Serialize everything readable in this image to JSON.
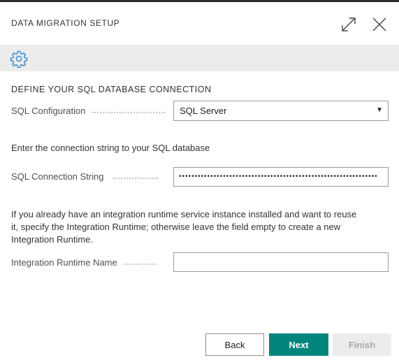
{
  "dialog": {
    "title": "DATA MIGRATION SETUP",
    "expand_icon": "expand-icon",
    "close_icon": "close-icon"
  },
  "action_bar": {
    "settings_icon": "gear-icon"
  },
  "section": {
    "title": "DEFINE YOUR SQL DATABASE CONNECTION"
  },
  "sql_configuration": {
    "label": "SQL Configuration",
    "value": "SQL Server"
  },
  "connection_string": {
    "instructions": "Enter the connection string to your SQL database",
    "label": "SQL Connection String",
    "masked_value": "•••••••••••••••••••••••••••••••••••••••••••••••••••••••••••••••"
  },
  "integration_runtime": {
    "description_lines": [
      "If you already have an integration runtime service instance installed and want to reuse",
      "it, specify the Integration Runtime; otherwise leave the field empty to create a new",
      "Integration Runtime."
    ],
    "label": "Integration Runtime Name",
    "value": ""
  },
  "buttons": {
    "back": "Back",
    "next": "Next",
    "finish": "Finish"
  },
  "colors": {
    "accent": "#00857d",
    "icon_blue": "#2a7fc3",
    "action_bar": "#ececec"
  }
}
